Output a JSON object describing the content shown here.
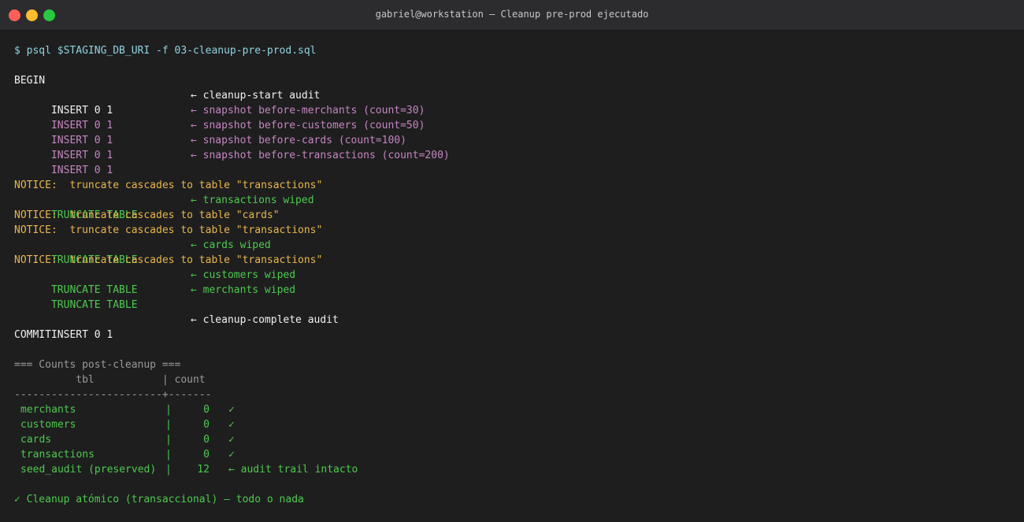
{
  "window": {
    "title": "gabriel@workstation — Cleanup pre-prod ejecutado"
  },
  "terminal": {
    "command": "$ psql $STAGING_DB_URI -f 03-cleanup-pre-prod.sql",
    "begin": "BEGIN",
    "audit_start": {
      "status": "INSERT 0 1",
      "note": "← cleanup-start audit"
    },
    "snapshots": [
      {
        "status": "INSERT 0 1",
        "note": "← snapshot before-merchants (count=30)"
      },
      {
        "status": "INSERT 0 1",
        "note": "← snapshot before-customers (count=50)"
      },
      {
        "status": "INSERT 0 1",
        "note": "← snapshot before-cards (count=100)"
      },
      {
        "status": "INSERT 0 1",
        "note": "← snapshot before-transactions (count=200)"
      }
    ],
    "truncate_log": [
      {
        "kind": "notice",
        "text": "NOTICE:  truncate cascades to table \"transactions\""
      },
      {
        "kind": "truncate",
        "status": "TRUNCATE TABLE",
        "note": "← transactions wiped"
      },
      {
        "kind": "notice",
        "text": "NOTICE:  truncate cascades to table \"cards\""
      },
      {
        "kind": "notice",
        "text": "NOTICE:  truncate cascades to table \"transactions\""
      },
      {
        "kind": "truncate",
        "status": "TRUNCATE TABLE",
        "note": "← cards wiped"
      },
      {
        "kind": "notice",
        "text": "NOTICE:  truncate cascades to table \"transactions\""
      },
      {
        "kind": "truncate",
        "status": "TRUNCATE TABLE",
        "note": "← customers wiped"
      },
      {
        "kind": "truncate",
        "status": "TRUNCATE TABLE",
        "note": "← merchants wiped"
      }
    ],
    "audit_complete": {
      "status": "INSERT 0 1",
      "note": "← cleanup-complete audit"
    },
    "commit": "COMMIT",
    "counts": {
      "heading": "=== Counts post-cleanup ===",
      "header_line": "          tbl           | count",
      "divider": "------------------------+-------",
      "rows": [
        {
          "tbl": "merchants",
          "count": "0",
          "note": "✓"
        },
        {
          "tbl": "customers",
          "count": "0",
          "note": "✓"
        },
        {
          "tbl": "cards",
          "count": "0",
          "note": "✓"
        },
        {
          "tbl": "transactions",
          "count": "0",
          "note": "✓"
        },
        {
          "tbl": "seed_audit (preserved)",
          "count": "12",
          "note": "← audit trail intacto"
        }
      ]
    },
    "final_message": "✓ Cleanup atómico (transaccional) — todo o nada"
  }
}
